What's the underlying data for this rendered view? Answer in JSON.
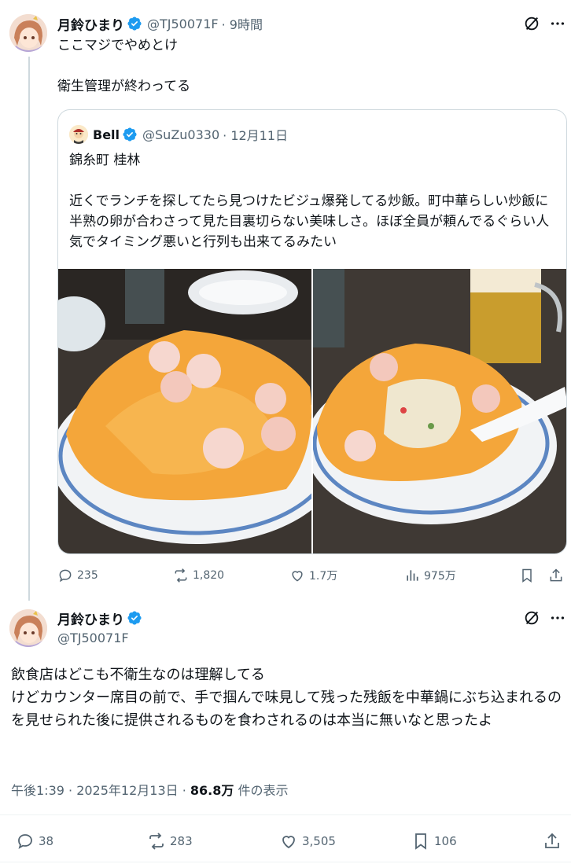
{
  "post1": {
    "display_name": "月鈴ひまり",
    "handle": "@TJ50071F",
    "time": "· 9時間",
    "text": "ここマジでやめとけ\n\n衛生管理が終わってる",
    "quote": {
      "display_name": "Bell",
      "handle": "@SuZu0330",
      "time": "· 12月11日",
      "text": "錦糸町 桂林\n\n近くでランチを探してたら見つけたビジュ爆発してる炒飯。町中華らしい炒飯に半熟の卵が合わさって見た目裏切らない美味しさ。ほぼ全員が頼んでるぐらい人気でタイミング悪いと行列も出来てるみたい"
    },
    "stats": {
      "replies": "235",
      "reposts": "1,820",
      "likes": "1.7万",
      "views": "975万"
    }
  },
  "post2": {
    "display_name": "月鈴ひまり",
    "handle": "@TJ50071F",
    "text": "飲食店はどこも不衛生なのは理解してる\nけどカウンター席目の前で、手で掴んで味見して残った残飯を中華鍋にぶち込まれるのを見せられた後に提供されるものを食わされるのは本当に無いなと思ったよ",
    "timestamp": "午後1:39 · 2025年12月13日 · ",
    "views_count": "86.8万",
    "views_label": " 件の表示",
    "stats": {
      "replies": "38",
      "reposts": "283",
      "likes": "3,505",
      "bookmarks": "106"
    }
  },
  "icons": [
    "grok-icon",
    "more-icon",
    "verified-icon",
    "reply-icon",
    "repost-icon",
    "like-icon",
    "views-icon",
    "bookmark-icon",
    "share-icon"
  ],
  "colors": {
    "accent": "#1d9bf0",
    "text": "#0f1419",
    "secondary": "#536471",
    "border": "#cfd9de"
  }
}
